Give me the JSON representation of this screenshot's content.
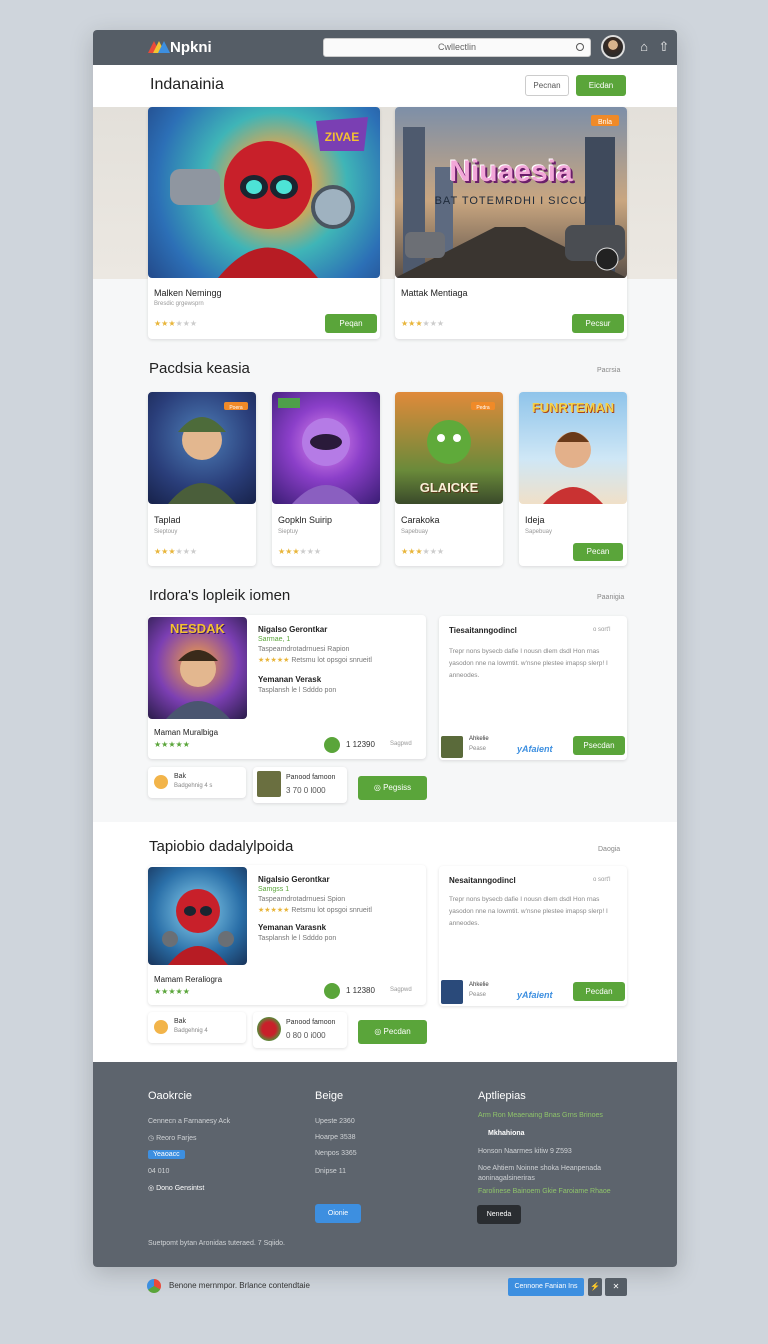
{
  "app": {
    "name": "Npkni"
  },
  "search": {
    "placeholder": "Cwllectlin"
  },
  "header": {
    "title": "Indanainia",
    "outline_button": "Pecnan",
    "green_button": "Eicdan"
  },
  "hero": [
    {
      "title": "Malken Nemingg",
      "sub": "Bresdic grgewsprn",
      "rating": 3,
      "button": "Peqan",
      "badge": ""
    },
    {
      "title": "Mattak Mentiaga",
      "sub": "",
      "rating": 3,
      "button": "Pecsur",
      "badge": "Bnla",
      "art_title": "Niuaesia",
      "art_sub": "BAT TOTEMRDHI I SICCU"
    }
  ],
  "section1": {
    "title": "Pacdsia keasia",
    "link": "Pacrsia",
    "cards": [
      {
        "title": "Taplad",
        "sub": "Sieptouy",
        "rating": 3,
        "button": "",
        "badge": "Poera"
      },
      {
        "title": "Gopkln Suirip",
        "sub": "Sieptuy",
        "rating": 3,
        "button": "",
        "badge": ""
      },
      {
        "title": "Carakoka",
        "sub": "Sapebuay",
        "rating": 3,
        "button": "",
        "badge": "Pedra",
        "art_text": "GLAICKE"
      },
      {
        "title": "Ideja",
        "sub": "Sapebuay",
        "rating": 0,
        "button": "Pecan",
        "badge": "",
        "art_text": "FUNRTEMAN"
      }
    ]
  },
  "section2": {
    "title": "Irdora's lopleik iomen",
    "link": "Paanigia",
    "feature": {
      "art_text": "NESDAK",
      "name": "Nigalso Gerontkar",
      "tag": "Sarmae, 1",
      "desc": "Taspeamdrotadrnuesi Rapion",
      "rating_text": "Retsmu lot opsgoi snrueitl",
      "sub_name": "Yemanan Verask",
      "sub_desc": "Tasplansh le l Sdddo pon",
      "caption": "Maman Muralbiga",
      "stat": "1 12390",
      "stat_label": "Sagpwd"
    },
    "panel": {
      "title": "Tiesaitanngodincl",
      "tag": "o sort'l",
      "body": "Trepr nons bysecb dafie I nousn dlem dsdl Hon rnas yasodon nne na lowmtit. w'nsne plestee imapsp slerp! I anneodes.",
      "mini_title": "Ahkelie",
      "mini_sub": "Pease",
      "brand": "yAfaient",
      "button": "Psecdan"
    },
    "chips": [
      {
        "title": "Bak",
        "sub": "Badgehnig 4 s"
      },
      {
        "title": "Panood famoon",
        "sub": "3 70 0 l000"
      }
    ],
    "action": "Pegsiss"
  },
  "section3": {
    "title": "Tapiobio dadalylpoida",
    "link": "Daogia",
    "feature": {
      "name": "Nigalsio Gerontkar",
      "tag": "Samgss 1",
      "desc": "Taspeamdrotadrnuesi Spion",
      "rating_text": "Retsmu lot opsgoi snrueitl",
      "sub_name": "Yemanan Varasnk",
      "sub_desc": "Tasplansh le l Sdddo pon",
      "caption": "Mamam Reraliogra",
      "stat": "1 12380",
      "stat_label": "Sagpwd"
    },
    "panel": {
      "title": "Nesaitanngodincl",
      "tag": "o sort'l",
      "body": "Trepr nons bysecb dafie I nousn dlem dsdl Hon rnas yasodon nne na lowmtit. w'nsne plestee imapsp slerp! I anneodes.",
      "mini_title": "Ahkelie",
      "mini_sub": "Pease",
      "brand": "yAfaient",
      "button": "Pecdan"
    },
    "chips": [
      {
        "title": "Bak",
        "sub": "Badgehnig 4"
      },
      {
        "title": "Panood famoon",
        "sub": "0 80 0 i000"
      }
    ],
    "action": "Pecdan"
  },
  "footer": {
    "col1": {
      "title": "Oaokrcie",
      "line1": "Cennecn a Farnanesy Ack",
      "line2": "Reoro Farjes",
      "badge": "Yeaoacc",
      "line3": "04 010",
      "line4": "Dono Gensintst"
    },
    "col2": {
      "title": "Beige",
      "rows": [
        [
          "Upeste",
          "2360"
        ],
        [
          "Hoarpe",
          "3538"
        ],
        [
          "Nenpos",
          "3365"
        ],
        [
          "Dnipse",
          "11"
        ]
      ],
      "button": "Oionie"
    },
    "col3": {
      "title": "Aptliepias",
      "line1": "Arm Ron Meaenaing Bnas Grns Brinoes",
      "line2": "Mkhahiona",
      "line3": "Honson Naarmes kitiw  9 Z593",
      "line4": "Noe Ahtiem Noinne shoka Heanpenada aoninagalsineriras",
      "line5": "Farolinese Bainoem Gkie Faroiame Rhaoe",
      "button": "Neneda"
    },
    "copyright": "Suetpomt bytan Aronidas tuteraed. 7 Sqiido."
  },
  "bottombar": {
    "text": "Benone mernmpor. Brlance contendtaie",
    "button": "Cennone Fanian Ins"
  },
  "colors": {
    "green": "#5aa53a",
    "blue": "#3d8fe0",
    "topbar": "#555d66",
    "footer": "#5d646d"
  }
}
